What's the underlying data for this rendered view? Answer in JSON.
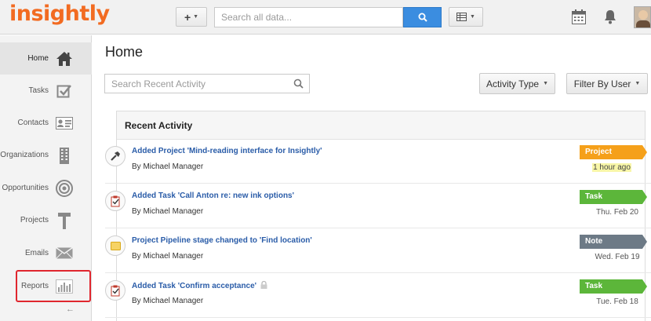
{
  "app": {
    "logo": "insightly"
  },
  "topbar": {
    "add_label": "+",
    "search_placeholder": "Search all data...",
    "icons": [
      "plus-icon",
      "search-icon",
      "grid-view-icon",
      "calendar-icon",
      "bell-icon",
      "avatar"
    ]
  },
  "sidebar": {
    "items": [
      {
        "label": "Home",
        "icon": "home-icon"
      },
      {
        "label": "Tasks",
        "icon": "tasks-checkbox-icon"
      },
      {
        "label": "Contacts",
        "icon": "contact-card-icon"
      },
      {
        "label": "Organizations",
        "icon": "building-icon"
      },
      {
        "label": "Opportunities",
        "icon": "target-icon"
      },
      {
        "label": "Projects",
        "icon": "hammer-icon"
      },
      {
        "label": "Emails",
        "icon": "envelope-icon"
      },
      {
        "label": "Reports",
        "icon": "bar-chart-icon"
      }
    ],
    "active": "Home",
    "highlighted": "Reports",
    "collapse_arrow": "←"
  },
  "main": {
    "title": "Home",
    "activity_search_placeholder": "Search Recent Activity",
    "activity_type_label": "Activity Type",
    "filter_by_user_label": "Filter By User",
    "panel_title": "Recent Activity",
    "activities": [
      {
        "title": "Added Project 'Mind-reading interface for Insightly'",
        "by": "By Michael Manager",
        "badge": "Project",
        "badge_color": "#f5a01a",
        "time": "1 hour ago",
        "time_highlight": true,
        "icon": "hammer-icon"
      },
      {
        "title": "Added Task 'Call Anton re: new ink options'",
        "by": "By Michael Manager",
        "badge": "Task",
        "badge_color": "#5cb63a",
        "time": "Thu. Feb 20",
        "time_highlight": false,
        "icon": "task-clipboard-icon"
      },
      {
        "title": "Project Pipeline stage changed to 'Find location'",
        "by": "By Michael Manager",
        "badge": "Note",
        "badge_color": "#6d7a86",
        "time": "Wed. Feb 19",
        "time_highlight": false,
        "icon": "note-icon"
      },
      {
        "title": "Added Task 'Confirm acceptance'",
        "by": "By Michael Manager",
        "badge": "Task",
        "badge_color": "#5cb63a",
        "time": "Tue. Feb 18",
        "time_highlight": false,
        "icon": "task-clipboard-icon",
        "locked": true
      }
    ]
  }
}
